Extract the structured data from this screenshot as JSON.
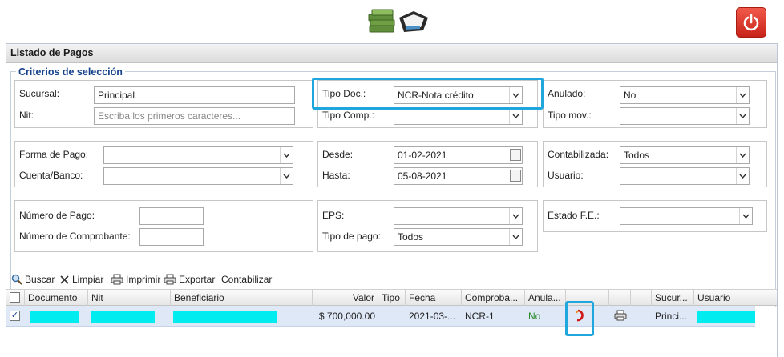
{
  "panel": {
    "title": "Listado de Pagos"
  },
  "criteria": {
    "legend": "Criterios de selección"
  },
  "filters": {
    "sucursal_label": "Sucursal:",
    "sucursal_value": "Principal",
    "nit_label": "Nit:",
    "nit_placeholder": "Escriba los primeros caracteres...",
    "tipo_doc_label": "Tipo Doc.:",
    "tipo_doc_value": "NCR-Nota crédito",
    "tipo_comp_label": "Tipo Comp.:",
    "tipo_comp_value": "",
    "anulado_label": "Anulado:",
    "anulado_value": "No",
    "tipo_mov_label": "Tipo mov.:",
    "tipo_mov_value": "",
    "forma_pago_label": "Forma de Pago:",
    "forma_pago_value": "",
    "cuenta_label": "Cuenta/Banco:",
    "cuenta_value": "",
    "desde_label": "Desde:",
    "desde_value": "01-02-2021",
    "hasta_label": "Hasta:",
    "hasta_value": "05-08-2021",
    "contabilizada_label": "Contabilizada:",
    "contabilizada_value": "Todos",
    "usuario_label": "Usuario:",
    "usuario_value": "",
    "numero_pago_label": "Número de Pago:",
    "numero_pago_value": "",
    "numero_comp_label": "Número de Comprobante:",
    "numero_comp_value": "",
    "eps_label": "EPS:",
    "eps_value": "",
    "tipo_pago_label": "Tipo de pago:",
    "tipo_pago_value": "Todos",
    "estado_fe_label": "Estado F.E.:",
    "estado_fe_value": ""
  },
  "toolbar": {
    "buscar": "Buscar",
    "limpiar": "Limpiar",
    "imprimir": "Imprimir",
    "exportar": "Exportar",
    "contabilizar": "Contabilizar"
  },
  "grid": {
    "columns": {
      "documento": "Documento",
      "nit": "Nit",
      "beneficiario": "Beneficiario",
      "valor": "Valor",
      "tipo": "Tipo",
      "fecha": "Fecha",
      "comprobante": "Comproba...",
      "anulado": "Anula...",
      "sucursal": "Sucur...",
      "usuario": "Usuario"
    },
    "rows": [
      {
        "checked": true,
        "valor": "$ 700,000.00",
        "tipo": "",
        "fecha": "2021-03-...",
        "comprobante": "NCR-1",
        "anulado": "No",
        "sucursal": "Princi..."
      }
    ]
  },
  "colors": {
    "highlight": "#1fa6dd",
    "redaction": "#00ecef",
    "anulado_text": "#2a8a2a",
    "legend_text": "#15428b",
    "power_button": "#d9342b"
  },
  "icons": [
    "logo-icon",
    "power-icon",
    "search-icon",
    "clear-x-icon",
    "printer-icon",
    "export-icon",
    "pdf-icon",
    "calendar-icon",
    "chevron-down-icon"
  ]
}
